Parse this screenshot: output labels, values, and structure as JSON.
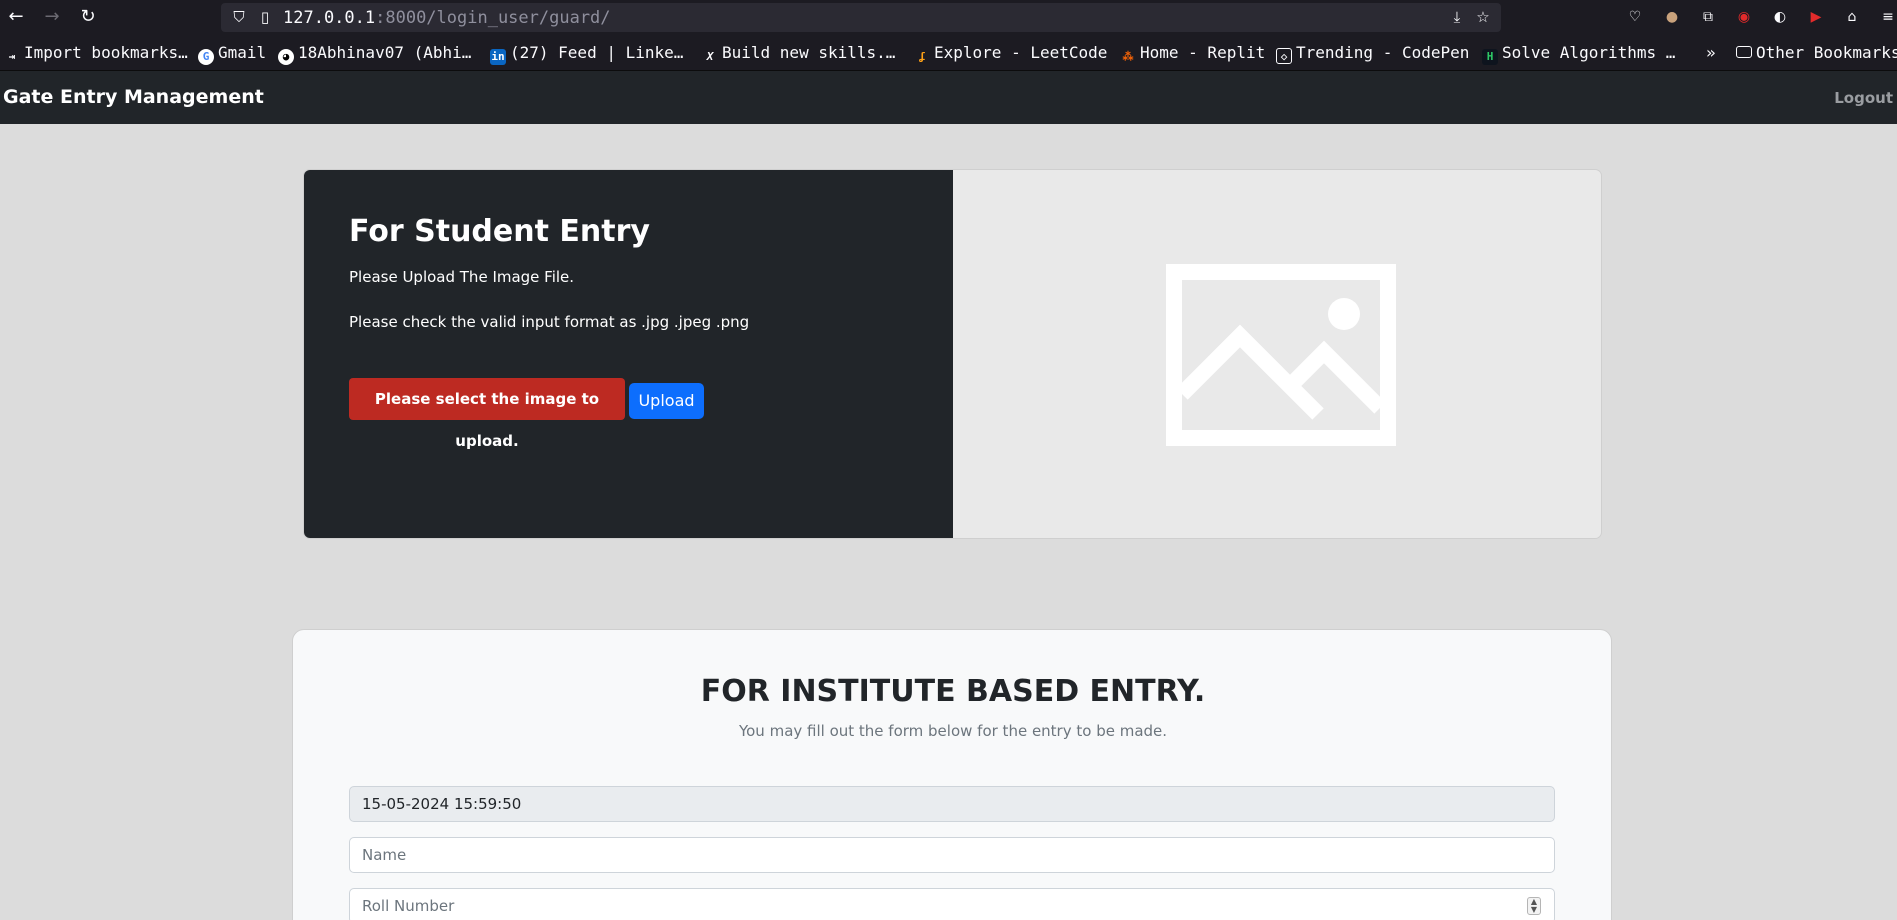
{
  "browser": {
    "url_host": "127.0.0.1",
    "url_rest": ":8000/login_user/guard/",
    "bookmarks": [
      {
        "label": "Import bookmarks…",
        "icon": "import-icon"
      },
      {
        "label": "Gmail",
        "icon": "google-icon"
      },
      {
        "label": "18Abhinav07 (Abhi…",
        "icon": "github-icon"
      },
      {
        "label": "(27) Feed | Linke…",
        "icon": "linkedin-icon"
      },
      {
        "label": "Build new skills.…",
        "icon": "x-icon"
      },
      {
        "label": "Explore - LeetCode",
        "icon": "leetcode-icon"
      },
      {
        "label": "Home - Replit",
        "icon": "replit-icon"
      },
      {
        "label": "Trending - CodePen",
        "icon": "codepen-icon"
      },
      {
        "label": "Solve Algorithms …",
        "icon": "hackerrank-icon"
      }
    ],
    "overflow_label": "»",
    "other_bookmarks": "Other Bookmarks"
  },
  "navbar": {
    "brand": "Gate Entry Management",
    "logout": "Logout"
  },
  "student_card": {
    "title": "For Student Entry",
    "text1": "Please Upload The Image File.",
    "text2": "Please check the valid input format as .jpg .jpeg .png",
    "error_button": "Please select the image to upload.",
    "upload_button": "Upload"
  },
  "institute_form": {
    "title": "FOR INSTITUTE BASED ENTRY.",
    "subtitle": "You may fill out the form below for the entry to be made.",
    "datetime_value": "15-05-2024 15:59:50",
    "name_placeholder": "Name",
    "roll_placeholder": "Roll Number"
  },
  "colors": {
    "navbar": "#212529",
    "error": "#bd2a22",
    "primary": "#0d6efd"
  }
}
